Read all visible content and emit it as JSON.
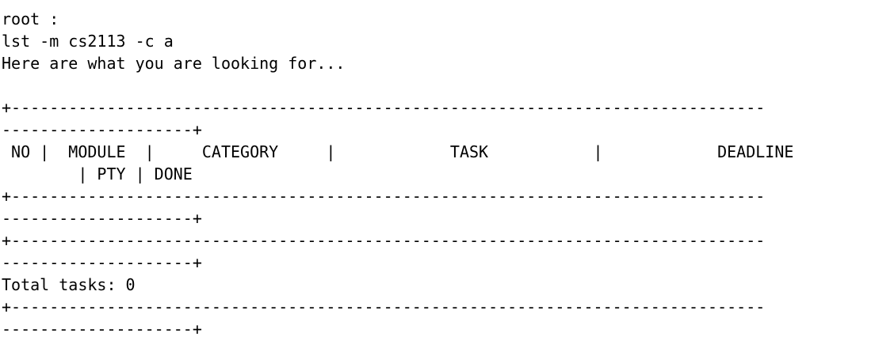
{
  "terminal": {
    "prompt": "root :",
    "command": "lst -m cs2113 -c a",
    "response": "Here are what you are looking for...",
    "rule_a": "+-------------------------------------------------------------------------------",
    "rule_b": "--------------------+",
    "header_a": " NO |  MODULE  |     CATEGORY     |            TASK           |            DEADLINE",
    "header_b": "        | PTY | DONE",
    "total": "Total tasks: 0"
  }
}
